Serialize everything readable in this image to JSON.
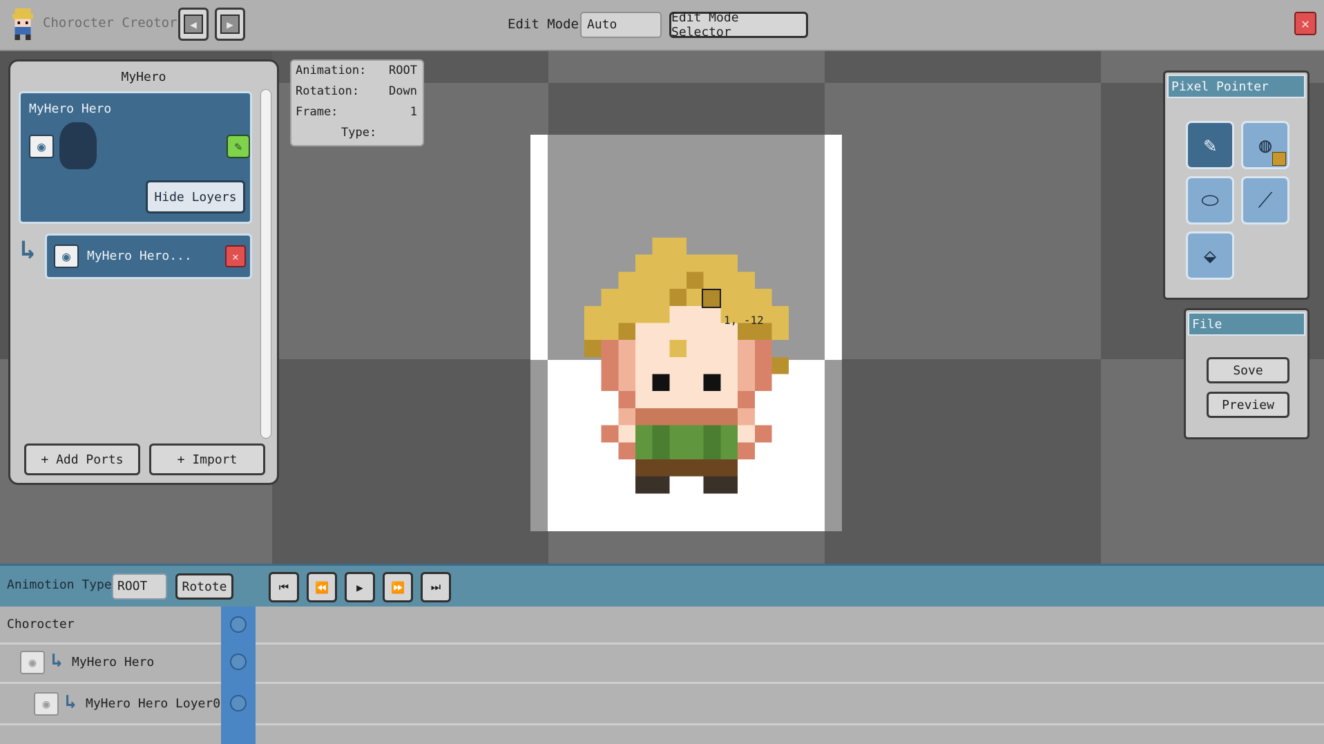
{
  "app": {
    "title": "Chorocter Creotor",
    "undo_icon": "undo-icon",
    "redo_icon": "redo-icon",
    "close_icon": "close-icon",
    "close_glyph": "✕"
  },
  "edit_mode": {
    "label": "Edit Mode",
    "value": "Auto",
    "selector_label": "Edit Mode Selector"
  },
  "parts_panel": {
    "title": "MyHero",
    "card": {
      "title": "MyHero Hero",
      "eye_glyph": "◉",
      "edit_glyph": "✎",
      "hide_layers_label": "Hide Loyers"
    },
    "layers": [
      {
        "label": "MyHero Hero...",
        "eye_glyph": "◉",
        "delete_glyph": "✕"
      }
    ],
    "add_parts_label": "+ Add Ports",
    "import_label": "+ Import"
  },
  "info": {
    "animation_label": "Animation:",
    "animation_value": "ROOT",
    "rotation_label": "Rotation:",
    "rotation_value": "Down",
    "frame_label": "Frame:",
    "frame_value": "1",
    "type_label": "Type:",
    "type_value": ""
  },
  "canvas": {
    "cursor_coord": "1, -12"
  },
  "pixel_painter": {
    "title": "Pixel Pointer",
    "tools": [
      {
        "name": "brush",
        "glyph": "✎",
        "active": true
      },
      {
        "name": "color-picker",
        "glyph": "◍",
        "active": false
      },
      {
        "name": "eraser",
        "glyph": "⬭",
        "active": false
      },
      {
        "name": "eyedropper",
        "glyph": "⟋",
        "active": false
      },
      {
        "name": "fill",
        "glyph": "⬙",
        "active": false
      }
    ],
    "selected_color": "#c8962a"
  },
  "file_panel": {
    "title": "File",
    "save_label": "Sove",
    "preview_label": "Preview"
  },
  "timeline": {
    "animation_type_label": "Animotion Type",
    "animation_type_value": "ROOT",
    "rotate_label": "Rotote",
    "playback": [
      {
        "name": "first-frame",
        "glyph": "⏮"
      },
      {
        "name": "prev-frame",
        "glyph": "⏪"
      },
      {
        "name": "play",
        "glyph": "▶"
      },
      {
        "name": "next-frame",
        "glyph": "⏩"
      },
      {
        "name": "last-frame",
        "glyph": "⏭"
      }
    ],
    "rows": [
      {
        "label": "Chorocter",
        "eye_glyph": "",
        "arrow": ""
      },
      {
        "label": "MyHero Hero",
        "eye_glyph": "◉",
        "arrow": "↳"
      },
      {
        "label": "MyHero Hero Loyer0",
        "eye_glyph": "◉",
        "arrow": "↳"
      }
    ]
  },
  "colors": {
    "accent": "#5b8fa5",
    "panel_blue": "#3d6a8d",
    "close_red": "#e05050"
  }
}
